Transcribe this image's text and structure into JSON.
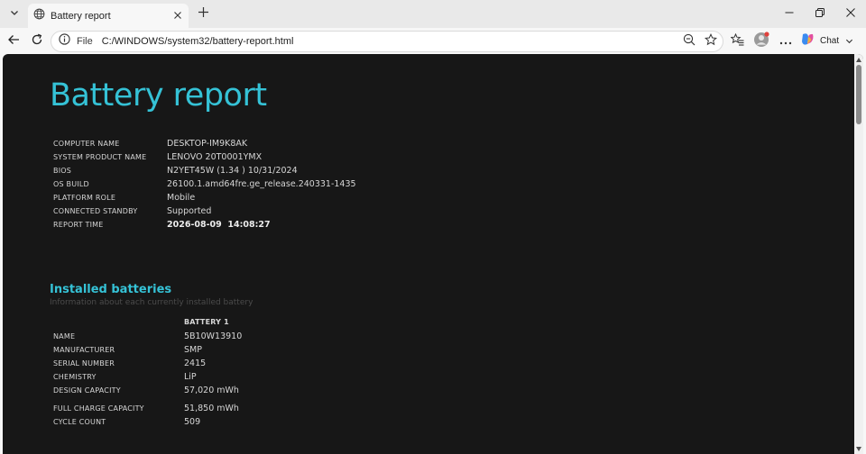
{
  "browser": {
    "tab_title": "Battery report",
    "address_scheme": "File",
    "address_url": "C:/WINDOWS/system32/battery-report.html",
    "chat_label": "Chat"
  },
  "report": {
    "title": "Battery report",
    "system_info": [
      {
        "label": "COMPUTER NAME",
        "value": "DESKTOP-IM9K8AK"
      },
      {
        "label": "SYSTEM PRODUCT NAME",
        "value": "LENOVO 20T0001YMX"
      },
      {
        "label": "BIOS",
        "value": "N2YET45W (1.34 ) 10/31/2024"
      },
      {
        "label": "OS BUILD",
        "value": "26100.1.amd64fre.ge_release.240331-1435"
      },
      {
        "label": "PLATFORM ROLE",
        "value": "Mobile"
      },
      {
        "label": "CONNECTED STANDBY",
        "value": "Supported"
      },
      {
        "label": "REPORT TIME",
        "value": "2026-08-09  14:08:27"
      }
    ],
    "installed_batteries": {
      "title": "Installed batteries",
      "subtitle": "Information about each currently installed battery",
      "column_header": "BATTERY 1",
      "rows": [
        {
          "label": "NAME",
          "value": "5B10W13910"
        },
        {
          "label": "MANUFACTURER",
          "value": "SMP"
        },
        {
          "label": "SERIAL NUMBER",
          "value": "2415"
        },
        {
          "label": "CHEMISTRY",
          "value": "LiP"
        },
        {
          "label": "DESIGN CAPACITY",
          "value": "57,020 mWh"
        },
        {
          "label": "FULL CHARGE CAPACITY",
          "value": "51,850 mWh"
        },
        {
          "label": "CYCLE COUNT",
          "value": "509"
        }
      ]
    }
  },
  "colors": {
    "accent": "#35c2d6",
    "page_background": "#171717",
    "text": "#d6d6d6"
  },
  "icons": {
    "tab_actions": "chevron-down-icon",
    "tab_favicon": "globe-icon",
    "tab_close": "close-icon",
    "new_tab": "plus-icon",
    "back": "arrow-left-icon",
    "refresh": "refresh-icon",
    "site_info": "info-icon",
    "zoom": "zoom-out-icon",
    "favorite": "star-icon",
    "favorites": "favorites-list-icon",
    "profile": "avatar-icon",
    "more": "more-icon",
    "copilot": "copilot-icon"
  }
}
